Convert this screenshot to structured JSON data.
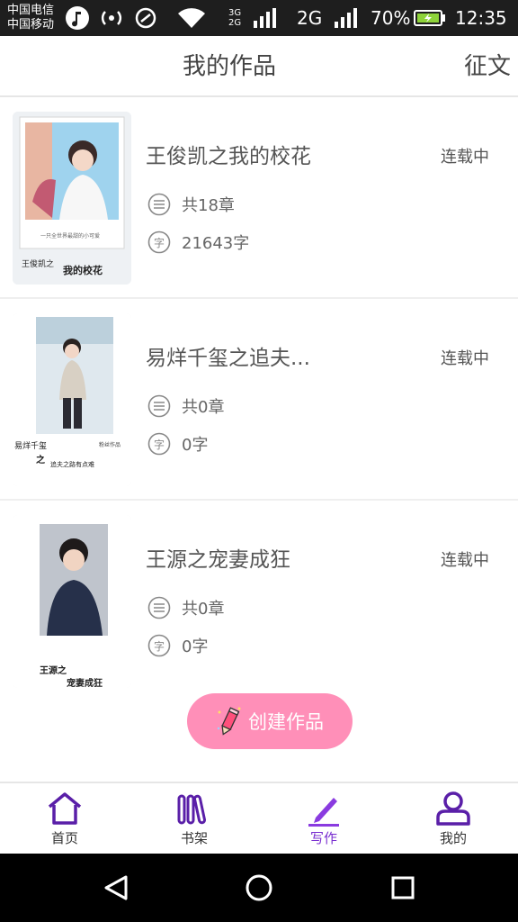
{
  "status_bar": {
    "carrier_1": "中国电信",
    "carrier_2": "中国移动",
    "network": "2G",
    "network_small_top": "3G",
    "network_small_bottom": "2G",
    "battery": "70%",
    "time": "12:35"
  },
  "header": {
    "title": "我的作品",
    "action_label": "征文"
  },
  "works": [
    {
      "title": "王俊凯之我的校花",
      "status": "连载中",
      "chapters": "共18章",
      "words": "21643字"
    },
    {
      "title": "易烊千玺之追夫...",
      "status": "连载中",
      "chapters": "共0章",
      "words": "0字"
    },
    {
      "title": "王源之宠妻成狂",
      "status": "连载中",
      "chapters": "共0章",
      "words": "0字"
    }
  ],
  "covers": [
    {
      "text_1": "王俊凯之",
      "text_2": "我的校花",
      "caption": "一只全世界最甜的小可爱"
    },
    {
      "text_1": "易烊千玺",
      "text_2": "之",
      "text_3": "追夫之路有点难",
      "side_text": "粉丝作品"
    },
    {
      "text_1": "王源之",
      "text_2": "宠妻成狂"
    }
  ],
  "meta_icons": {
    "chapters": "list-icon",
    "words": "zi-icon",
    "zi_glyph": "字"
  },
  "create_button": {
    "label": "创建作品",
    "icon": "pencil-icon",
    "color": "#ff8fb8"
  },
  "bottom_nav": [
    {
      "label": "首页",
      "icon": "home-icon"
    },
    {
      "label": "书架",
      "icon": "bookshelf-icon"
    },
    {
      "label": "写作",
      "icon": "write-icon",
      "active": true
    },
    {
      "label": "我的",
      "icon": "profile-icon"
    }
  ],
  "colors": {
    "accent": "#7a2fd0",
    "button_pink": "#ff8fb8",
    "statusbar": "#1e1e1e"
  }
}
